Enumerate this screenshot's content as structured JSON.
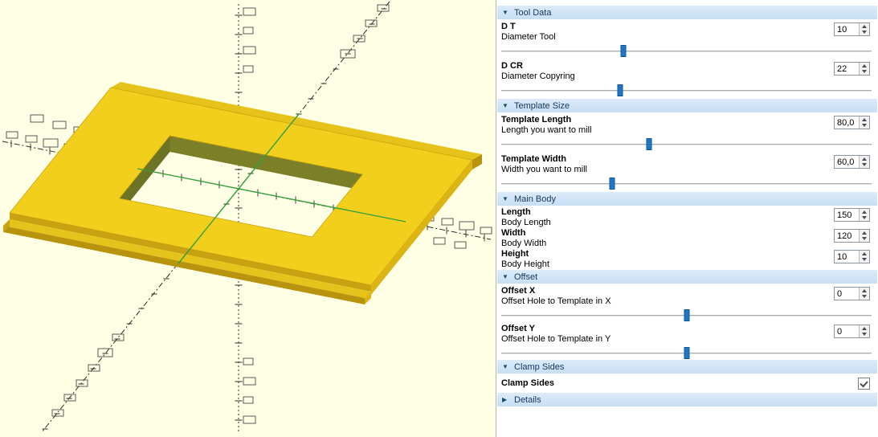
{
  "viewport": {
    "background": "#ffffe5",
    "colors": {
      "axis": "#2b2b2b",
      "label_box": "#4a4a4a",
      "model_top": "#f2cf1d",
      "model_right": "#dcb414",
      "model_front": "#c9a211",
      "rail_top": "#e6c31a",
      "rail_front": "#b8940e",
      "inner_wall_top": "#7b7f28",
      "inner_wall_left": "#6d7324",
      "highlight": "#35a03a"
    }
  },
  "panel": {
    "sections": [
      {
        "title": "Tool Data",
        "icon": "▼",
        "params": [
          {
            "name": "D T",
            "desc": "Diameter Tool",
            "value": "10",
            "slider": "33%"
          },
          {
            "name": "D CR",
            "desc": "Diameter Copyring",
            "value": "22",
            "slider": "32%"
          }
        ]
      },
      {
        "title": "Template Size",
        "icon": "▼",
        "params": [
          {
            "name": "Template Length",
            "desc": "Length you want to mill",
            "value": "80,0",
            "slider": "40%"
          },
          {
            "name": "Template Width",
            "desc": "Width you want to mill",
            "value": "60,0",
            "slider": "30%"
          }
        ]
      },
      {
        "title": "Main Body",
        "icon": "▼",
        "params": [
          {
            "name": "Length",
            "desc": "Body Length",
            "value": "150"
          },
          {
            "name": "Width",
            "desc": "Body Width",
            "value": "120"
          },
          {
            "name": "Height",
            "desc": "Body Height",
            "value": "10"
          }
        ]
      },
      {
        "title": "Offset",
        "icon": "▼",
        "params": [
          {
            "name": "Offset X",
            "desc": "Offset Hole to Template in X",
            "value": "0",
            "slider": "50%"
          },
          {
            "name": "Offset Y",
            "desc": "Offset Hole to Template in Y",
            "value": "0",
            "slider": "50%"
          }
        ]
      },
      {
        "title": "Clamp Sides",
        "icon": "▼",
        "params": [
          {
            "name": "Clamp Sides",
            "checked": true
          }
        ]
      },
      {
        "title": "Details",
        "icon": "▶",
        "params": []
      }
    ]
  }
}
